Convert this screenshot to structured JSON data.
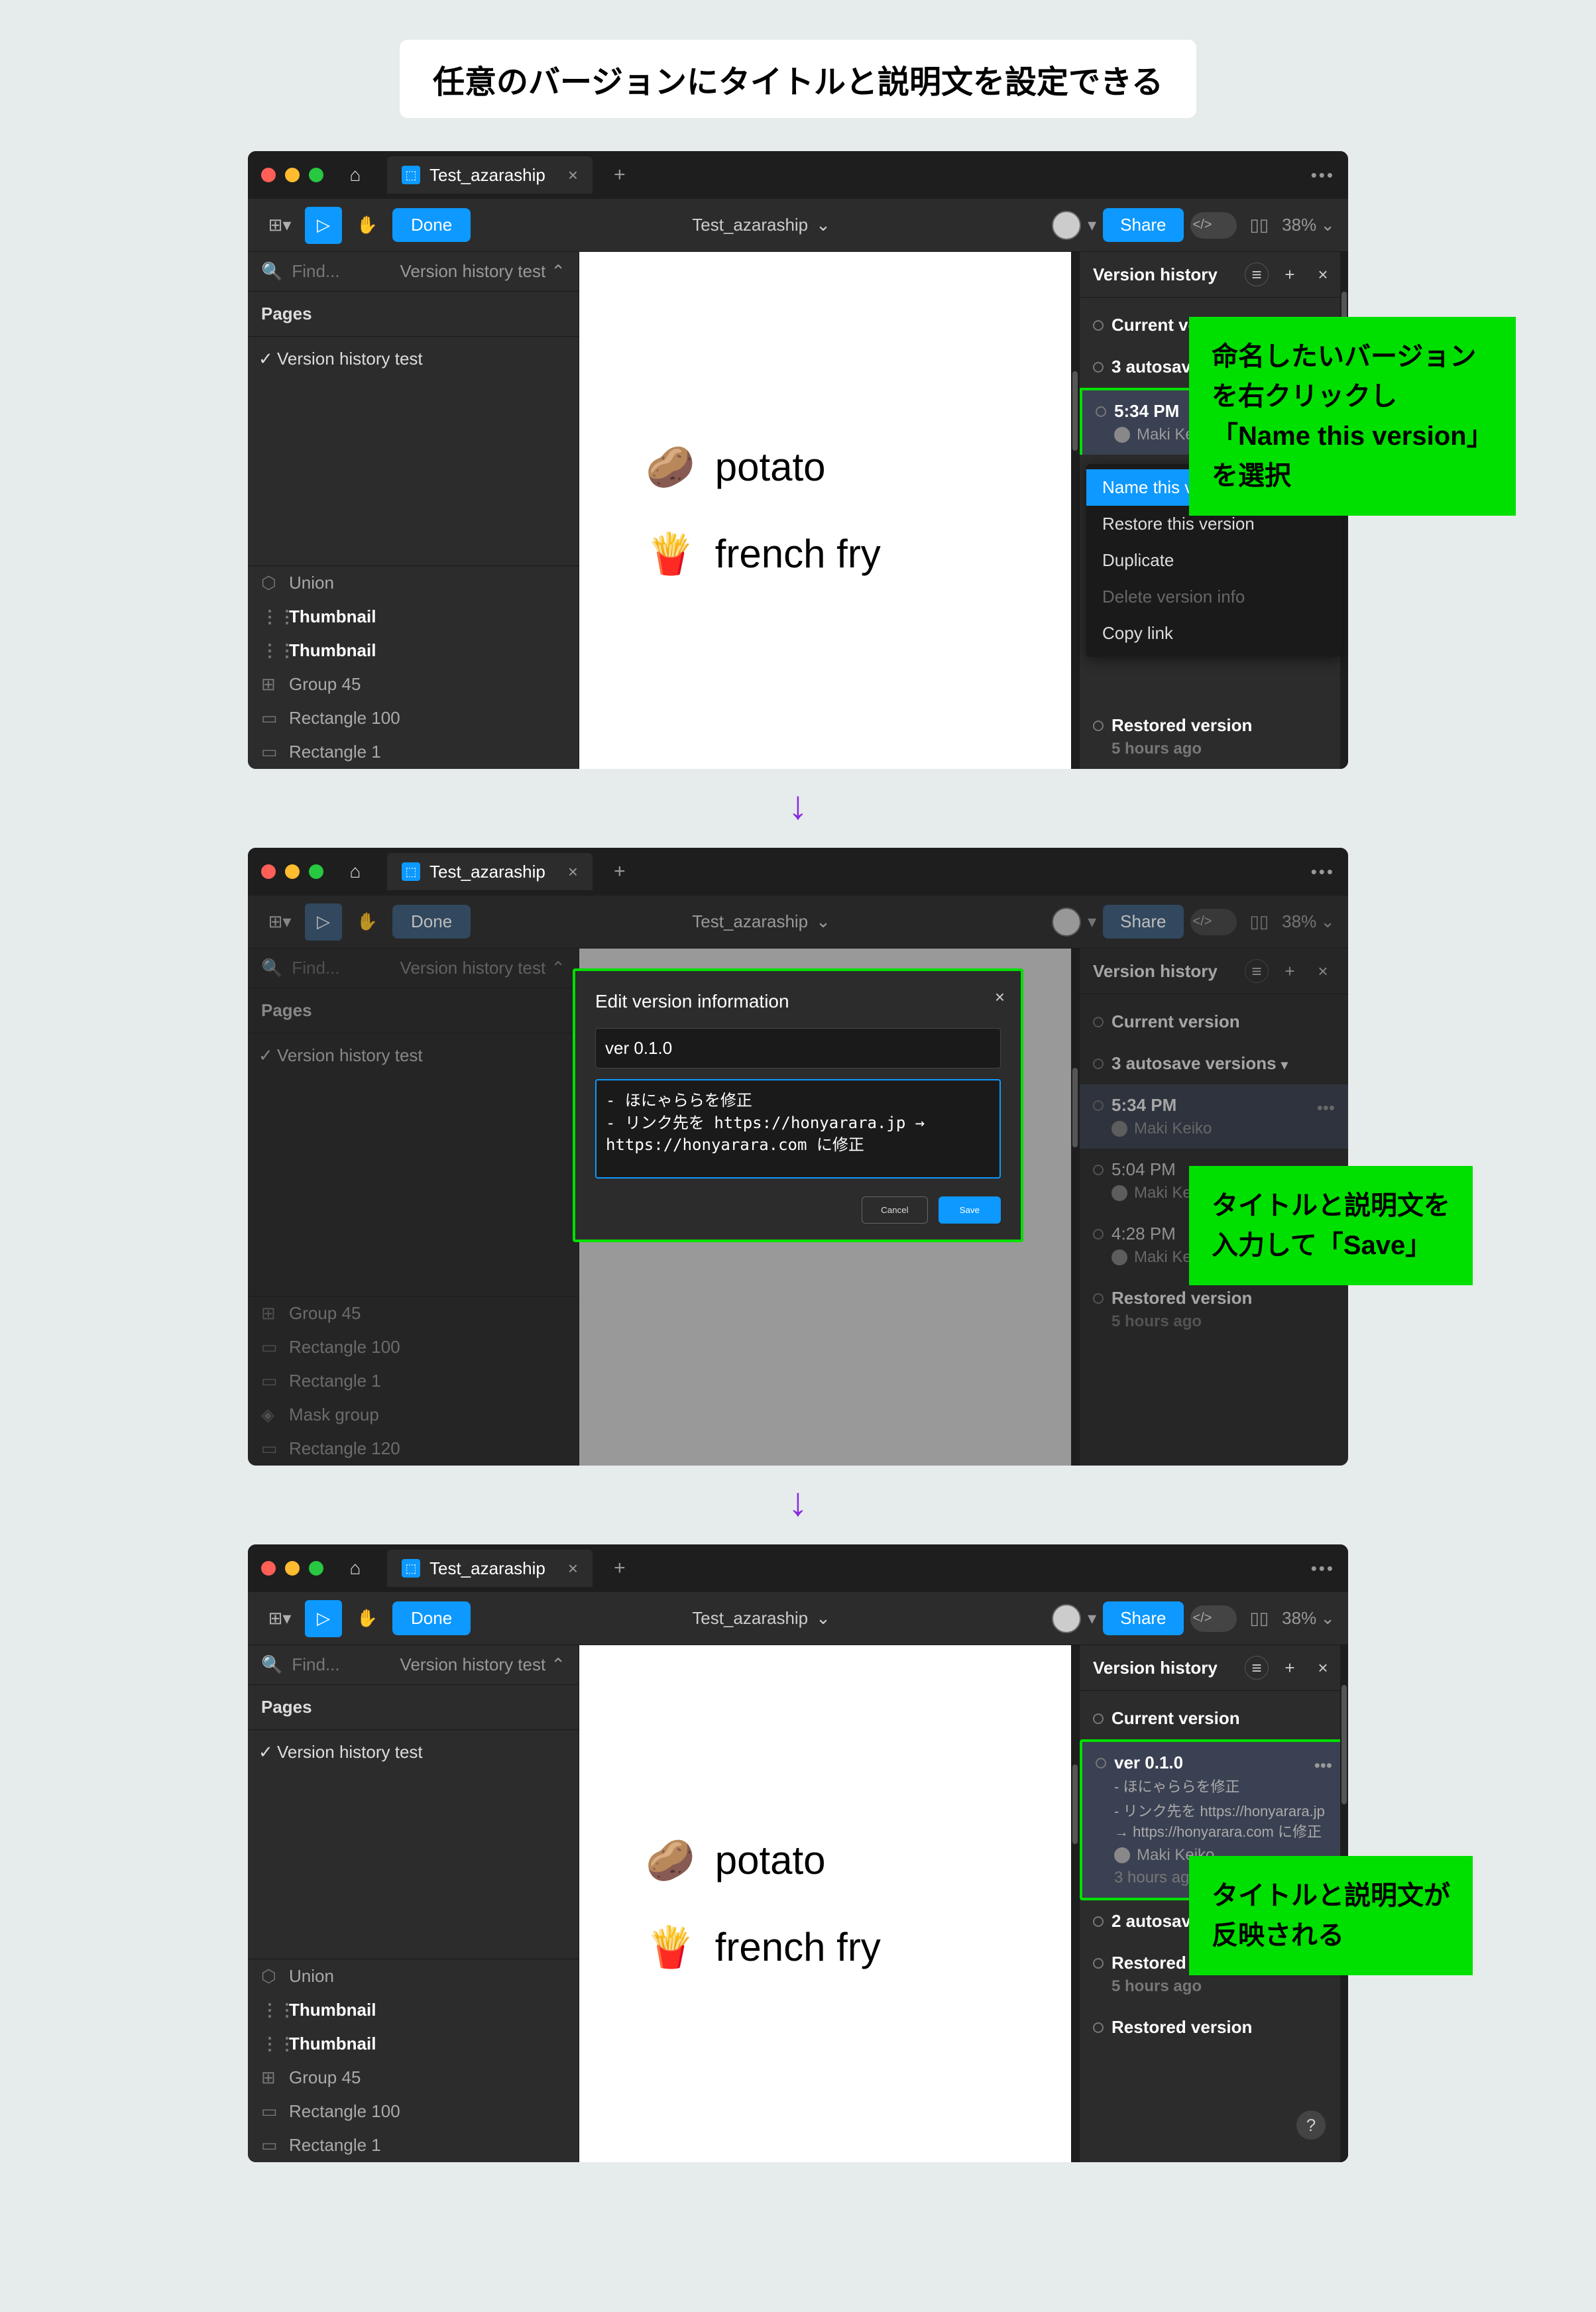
{
  "heading": "任意のバージョンにタイトルと説明文を設定できる",
  "tab_name": "Test_azaraship",
  "done": "Done",
  "file_title": "Test_azaraship",
  "share": "Share",
  "zoom": "38%",
  "find_placeholder": "Find...",
  "filter_label": "Version history test",
  "pages_label": "Pages",
  "page_item": "Version history test",
  "layers": [
    {
      "icon": "⬡",
      "label": "Union"
    },
    {
      "icon": "⋮⋮",
      "label": "Thumbnail",
      "bold": true
    },
    {
      "icon": "⋮⋮",
      "label": "Thumbnail",
      "bold": true
    },
    {
      "icon": "⊞",
      "label": "Group 45"
    },
    {
      "icon": "▭",
      "label": "Rectangle 100"
    },
    {
      "icon": "▭",
      "label": "Rectangle 1"
    }
  ],
  "layers2": [
    {
      "icon": "⊞",
      "label": "Group 45"
    },
    {
      "icon": "▭",
      "label": "Rectangle 100"
    },
    {
      "icon": "▭",
      "label": "Rectangle 1"
    },
    {
      "icon": "◈",
      "label": "Mask group"
    },
    {
      "icon": "▭",
      "label": "Rectangle 120"
    }
  ],
  "canvas_items": [
    {
      "emoji": "🥔",
      "label": "potato"
    },
    {
      "emoji": "🍟",
      "label": "french fry"
    }
  ],
  "vh": {
    "title": "Version history",
    "current": "Current version",
    "autosave": "3 autosave versions",
    "autosave2": "2 autosave versions",
    "v1_time": "5:34 PM",
    "v1_user": "Maki Keiko",
    "v2_time": "5:04 PM",
    "v2_user": "Maki Keiko",
    "v3_time": "4:28 PM",
    "v3_user": "Maki Keiko",
    "restored": "Restored version",
    "restored_sub": "5 hours ago",
    "named_title": "ver 0.1.0",
    "named_desc1": "- ほにゃららを修正",
    "named_desc2": "- リンク先を https://honyarara.jp → https://honyarara.com に修正",
    "named_user": "Maki Keiko",
    "named_ago": "3 hours ago"
  },
  "ctx": {
    "name": "Name this version",
    "restore": "Restore this version",
    "duplicate": "Duplicate",
    "delete": "Delete version info",
    "copy": "Copy link"
  },
  "callout1_l1": "命名したいバージョン",
  "callout1_l2": "を右クリックし",
  "callout1_l3": "「Name this version」",
  "callout1_l4": "を選択",
  "callout2_l1": "タイトルと説明文を",
  "callout2_l2": "入力して「Save」",
  "callout3_l1": "タイトルと説明文が",
  "callout3_l2": "反映される",
  "modal": {
    "title": "Edit version information",
    "input_value": "ver 0.1.0",
    "textarea_value": "- ほにゃららを修正\n- リンク先を https://honyarara.jp → https://honyarara.com に修正",
    "cancel": "Cancel",
    "save": "Save"
  }
}
